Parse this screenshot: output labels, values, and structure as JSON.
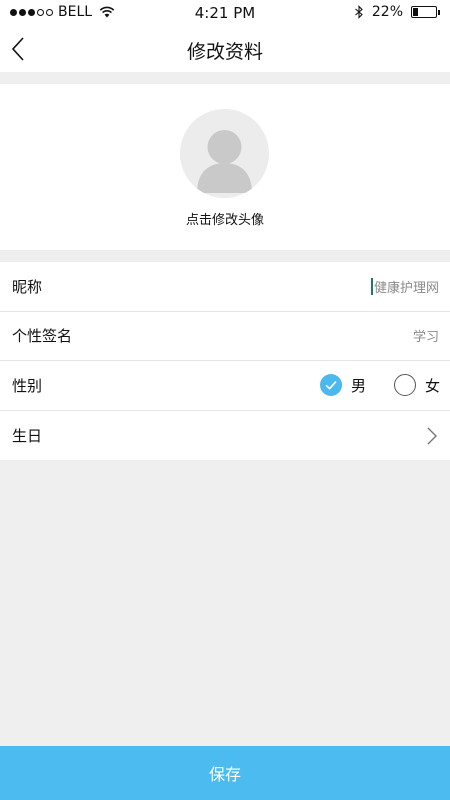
{
  "status_bar": {
    "carrier": "BELL",
    "time": "4:21 PM",
    "battery": "22%",
    "battery_level": 0.22,
    "signal_bars": 3,
    "signal_total": 5
  },
  "nav": {
    "title": "修改资料",
    "back_icon": "chevron-left-icon"
  },
  "avatar": {
    "hint": "点击修改头像"
  },
  "form": {
    "nickname": {
      "label": "昵称",
      "value": "健康护理网"
    },
    "signature": {
      "label": "个性签名",
      "value": "学习"
    },
    "gender": {
      "label": "性别",
      "options": [
        {
          "label": "男",
          "selected": true
        },
        {
          "label": "女",
          "selected": false
        }
      ]
    },
    "birthday": {
      "label": "生日",
      "value": ""
    }
  },
  "footer": {
    "save_label": "保存"
  },
  "colors": {
    "accent": "#4cbbf0",
    "background": "#f0efef",
    "caret": "#1c7a6b"
  }
}
